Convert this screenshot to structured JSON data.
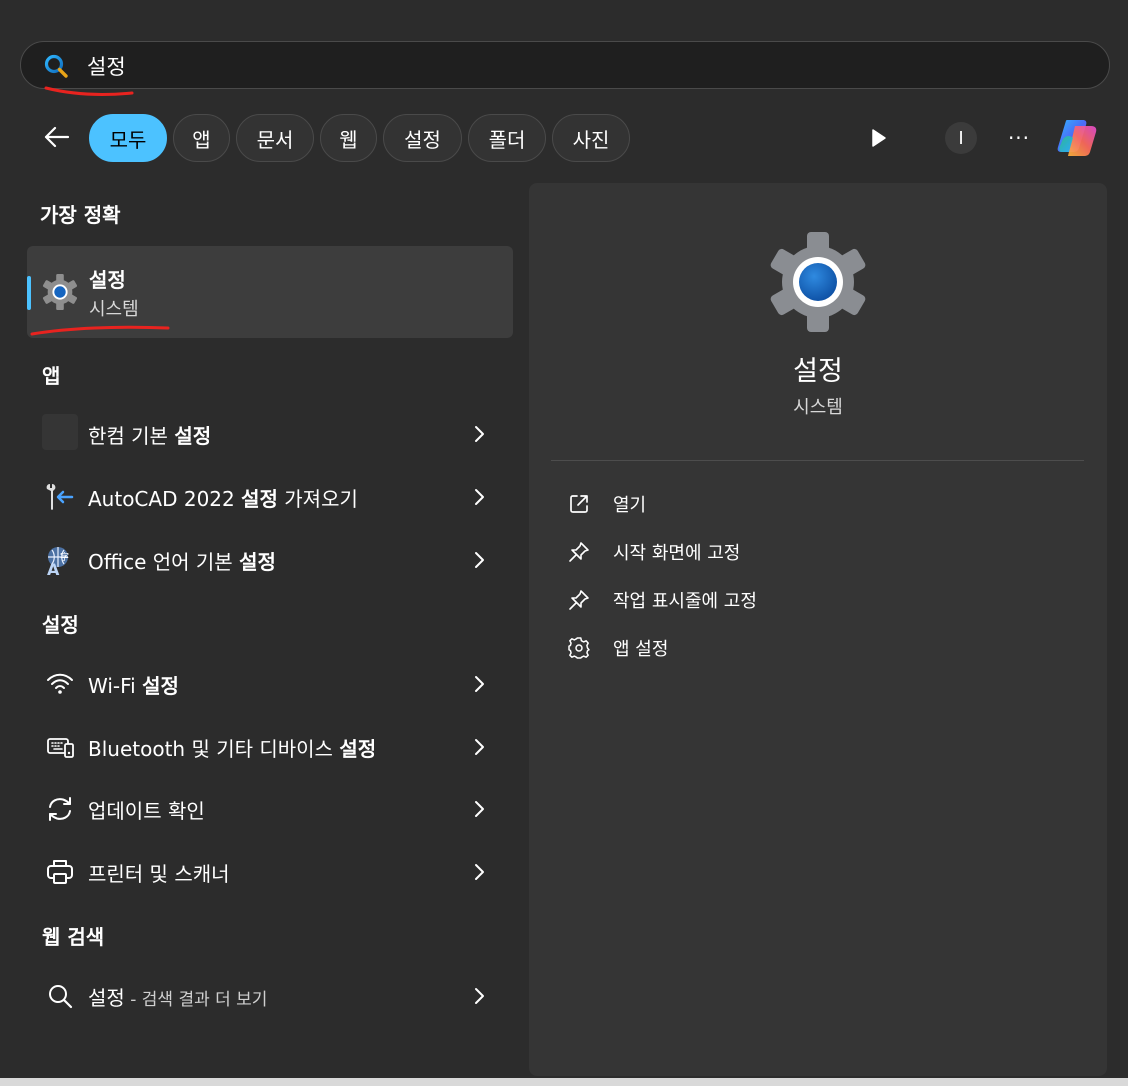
{
  "search": {
    "query": "설정"
  },
  "filters": [
    {
      "label": "모두",
      "active": true
    },
    {
      "label": "앱",
      "active": false
    },
    {
      "label": "문서",
      "active": false
    },
    {
      "label": "웹",
      "active": false
    },
    {
      "label": "설정",
      "active": false
    },
    {
      "label": "폴더",
      "active": false
    },
    {
      "label": "사진",
      "active": false
    }
  ],
  "toolbar": {
    "profile_label": "I",
    "more_label": "···"
  },
  "best_match": {
    "section_title": "가장 정확",
    "title": "설정",
    "subtitle": "시스템"
  },
  "apps": {
    "section_title": "앱",
    "items": [
      {
        "prefix": "한컴 기본 ",
        "bold": "설정",
        "suffix": ""
      },
      {
        "prefix": "AutoCAD 2022 ",
        "bold": "설정",
        "suffix": " 가져오기"
      },
      {
        "prefix": "Office 언어 기본 ",
        "bold": "설정",
        "suffix": ""
      }
    ]
  },
  "settings": {
    "section_title": "설정",
    "items": [
      {
        "prefix": "Wi-Fi ",
        "bold": "설정",
        "suffix": ""
      },
      {
        "prefix": "Bluetooth 및 기타 디바이스 ",
        "bold": "설정",
        "suffix": ""
      },
      {
        "prefix": "업데이트 확인",
        "bold": "",
        "suffix": ""
      },
      {
        "prefix": "프린터 및 스캐너",
        "bold": "",
        "suffix": ""
      }
    ]
  },
  "web": {
    "section_title": "웹 검색",
    "query": "설정",
    "suffix": " - 검색 결과 더 보기"
  },
  "detail": {
    "title": "설정",
    "subtitle": "시스템",
    "actions": [
      {
        "label": "열기",
        "icon": "open-external-icon"
      },
      {
        "label": "시작 화면에 고정",
        "icon": "pin-icon"
      },
      {
        "label": "작업 표시줄에 고정",
        "icon": "pin-icon"
      },
      {
        "label": "앱 설정",
        "icon": "gear-icon"
      }
    ]
  },
  "colors": {
    "accent": "#4cc2ff",
    "background": "#2c2c2c",
    "panel": "#353535",
    "annotation": "#e8231f"
  }
}
